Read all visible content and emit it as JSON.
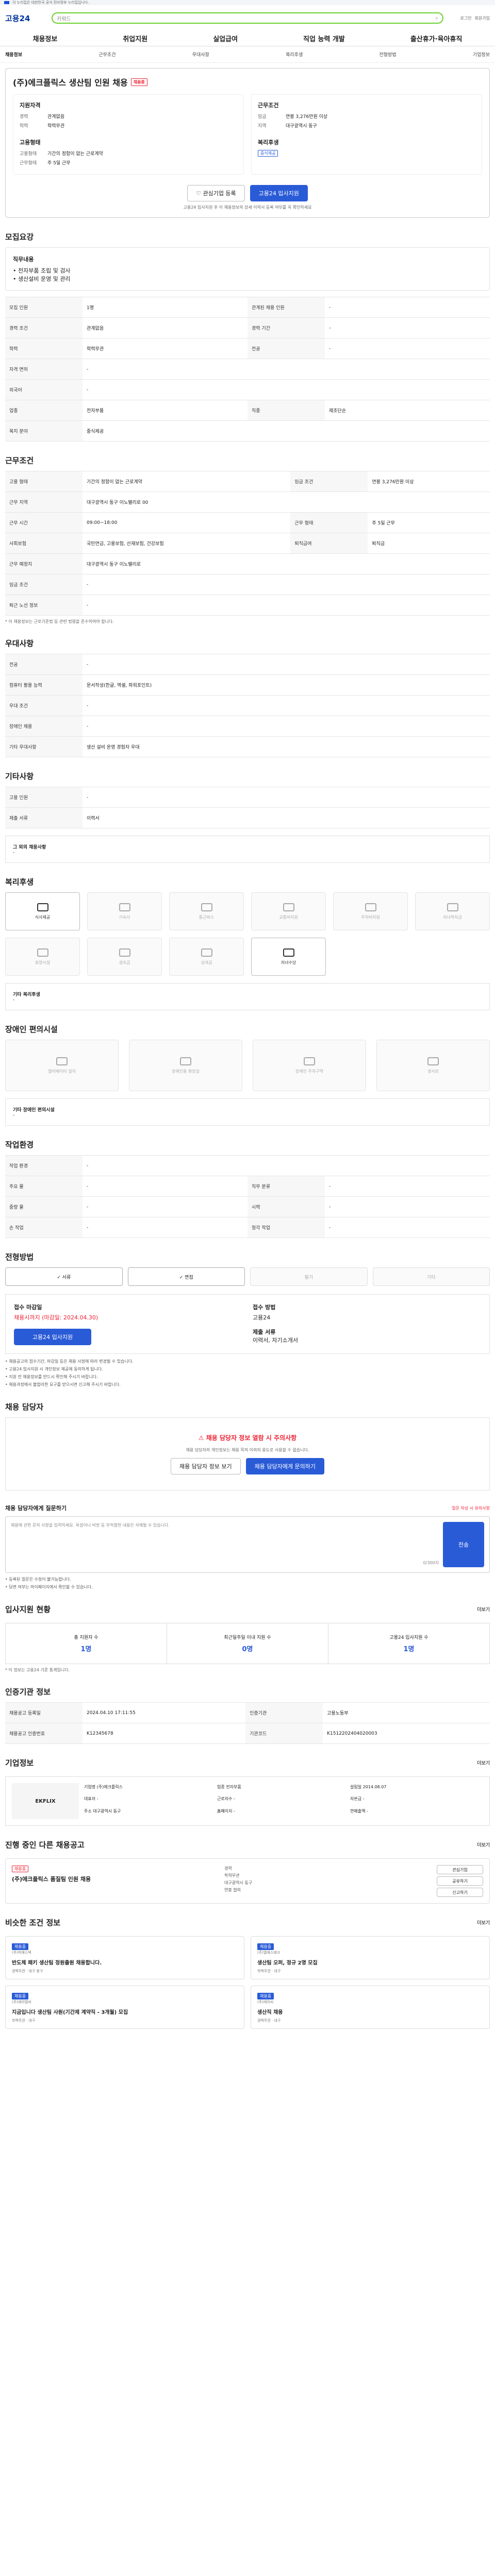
{
  "gov_banner": "이 누리집은 대한민국 공식 전자정부 누리집입니다.",
  "logo": "고용24",
  "search_placeholder": "키워드",
  "utils": [
    "로그인",
    "회원가입"
  ],
  "gnb": [
    "채용정보",
    "취업지원",
    "실업급여",
    "직업 능력 개발",
    "출산휴가·육아휴직"
  ],
  "tabs": [
    "채용정보",
    "근무조건",
    "우대사항",
    "복리후생",
    "전형방법",
    "기업정보"
  ],
  "header": {
    "company": "(주)에크플릭스 생산팀 인원 채용",
    "badge1": "채용중",
    "ref_title": "지원자격",
    "ref": [
      [
        "경력",
        "관계없음"
      ],
      [
        "학력",
        "학력무관"
      ]
    ],
    "cond_title": "근무조건",
    "cond": [
      [
        "임금",
        "연봉 3,276만원 이상"
      ],
      [
        "지역",
        "대구광역시 동구"
      ]
    ],
    "type_title": "고용형태",
    "type": [
      [
        "고용형태",
        "기간의 정함이 없는 근로계약"
      ],
      [
        "근무형태",
        "주 5일 근무"
      ]
    ],
    "welfare_title": "복리후생",
    "welfare": "중식제공"
  },
  "like_btn": "관심기업 등록",
  "apply_btn": "고용24 입사지원",
  "apply_note": "고용24 입사지원 후 이 채용정보의 상세 이력서 등록 여부를 꼭 확인하세요",
  "recruit": {
    "title": "모집요강",
    "task_label": "직무내용",
    "tasks": [
      "• 전자부품 조립 및 검사",
      "• 생산설비 운영 및 관리"
    ],
    "rows": [
      [
        "모집 인원",
        "1명",
        "관계된 채용 인원",
        "-"
      ],
      [
        "경력 조건",
        "관계없음",
        "경력 기간",
        "-"
      ],
      [
        "학력",
        "학력무관",
        "전공",
        "-"
      ],
      [
        "자격 면허",
        "-",
        "",
        ""
      ],
      [
        "외국어",
        "-",
        "",
        ""
      ],
      [
        "업종",
        "전자부품",
        "직종",
        "제조단순"
      ],
      [
        "복지 분야",
        "중식제공",
        "",
        ""
      ]
    ]
  },
  "work": {
    "title": "근무조건",
    "rows": [
      [
        "고용 형태",
        "기간의 정함이 없는 근로계약",
        "임금 조건",
        "연봉 3,276만원 이상"
      ],
      [
        "근무 지역",
        "대구광역시 동구 이노밸리로 00",
        "",
        ""
      ],
      [
        "근무 시간",
        "09:00~18:00",
        "근무 형태",
        "주 5일 근무"
      ],
      [
        "사회보험",
        "국민연금, 고용보험, 산재보험, 건강보험",
        "퇴직급여",
        "퇴직금"
      ],
      [
        "근무 예정지",
        "대구광역시 동구 이노밸리로",
        "",
        ""
      ],
      [
        "임금 조건",
        "-",
        "",
        ""
      ],
      [
        "퇴근 노선 정보",
        "-",
        "",
        ""
      ]
    ],
    "foot": "* 이 채용정보는 근로기준법 등 관련 법령을 준수하여야 합니다."
  },
  "pref": {
    "title": "우대사항",
    "rows": [
      [
        "전공",
        "-"
      ],
      [
        "컴퓨터 활용 능력",
        "문서작성(한글, 엑셀, 파워포인트)"
      ],
      [
        "우대 조건",
        "-"
      ],
      [
        "장애인 채용",
        "-"
      ],
      [
        "기타 우대사항",
        "생산 설비 운영 경험자 우대"
      ]
    ]
  },
  "other": {
    "title": "기타사항",
    "rows": [
      [
        "고용 인원",
        "-"
      ],
      [
        "제출 서류",
        "이력서"
      ]
    ],
    "box_title": "그 외의 채용사항",
    "box": "-"
  },
  "benefit": {
    "title": "복리후생",
    "items": [
      [
        "식사제공",
        true
      ],
      [
        "기숙사",
        false
      ],
      [
        "통근버스",
        false
      ],
      [
        "교통비지원",
        false
      ],
      [
        "주차비지원",
        false
      ],
      [
        "자녀학자금",
        false
      ],
      [
        "휴양시설",
        false
      ],
      [
        "경조금",
        false
      ],
      [
        "성과급",
        false
      ],
      [
        "자녀수당",
        true
      ]
    ],
    "other_title": "기타 복리후생",
    "other": "-"
  },
  "dis": {
    "title": "장애인 편의시설",
    "items": [
      "엘리베이터 설치",
      "장애인용 화장실",
      "장애인 주차구역",
      "경사로"
    ],
    "other_title": "기타 장애인 편의시설",
    "other": "-"
  },
  "workplace": {
    "title": "작업환경",
    "rows": [
      [
        "작업 환경",
        "-",
        "",
        ""
      ],
      [
        "주요 물",
        "-",
        "직무 분류",
        "-"
      ],
      [
        "중량 물",
        "-",
        "시력",
        "-"
      ],
      [
        "손 작업",
        "-",
        "청각 작업",
        "-"
      ]
    ]
  },
  "method": {
    "title": "전형방법",
    "items": [
      [
        "서류",
        true
      ],
      [
        "면접",
        true
      ],
      [
        "필기",
        false
      ],
      [
        "기타",
        false
      ]
    ],
    "apply_title": "접수 마감일",
    "apply_val": "채용시까지 (마감일: 2024.04.30)",
    "method_title": "접수 방법",
    "method_val": "고용24",
    "docs_title": "제출 서류",
    "docs_val": "이력서, 자기소개서",
    "apply_btn": "고용24 입사지원",
    "notes": [
      "• 채용공고의 접수기간, 마감일 등은 채용 사정에 따라 변경될 수 있습니다.",
      "• 고용24 입사지원 시 개인정보 제공에 동의하게 됩니다.",
      "• 지원 전 채용정보를 반드시 확인해 주시기 바랍니다.",
      "• 채용과정에서 불합리한 요구를 받으시면 신고해 주시기 바랍니다."
    ]
  },
  "contact": {
    "title": "채용 담당자",
    "warn": "채용 담당자 정보 열람 시 주의사항",
    "desc": "채용 담당자의 개인정보는 채용 목적 이외의 용도로 사용할 수 없습니다.",
    "btn1": "채용 담당자 정보 보기",
    "btn2": "채용 담당자에게 문의하기"
  },
  "qa": {
    "title": "채용 담당자에게 질문하기",
    "hint": "질문 작성 시 유의사항",
    "placeholder": "채용에 관한 문의 사항을 입력하세요. 욕설이나 비방 등 부적절한 내용은 삭제될 수 있습니다.",
    "count": "0/300자",
    "btn": "전송",
    "notes": [
      "• 등록된 질문은 수정이 불가능합니다.",
      "• 답변 여부는 마이페이지에서 확인할 수 있습니다."
    ]
  },
  "stats": {
    "title": "입사지원 현황",
    "more": "더보기",
    "items": [
      [
        "총 지원자 수",
        "1",
        "명"
      ],
      [
        "최근일주일 이내 지원 수",
        "0",
        "명"
      ],
      [
        "고용24 입사지원 수",
        "1",
        "명"
      ]
    ],
    "note": "* 이 정보는 고용24 기준 통계입니다."
  },
  "info": {
    "title": "인증기관 정보",
    "rows": [
      [
        "채용공고 등록일",
        "2024.04.10 17:11:55",
        "인증기관",
        "고용노동부"
      ],
      [
        "채용공고 인증번호",
        "K12345678",
        "기관코드",
        "K1512202404020003"
      ]
    ],
    "more": "기업 보기"
  },
  "corp": {
    "title": "기업정보",
    "more": "더보기",
    "logo": "EKFLIX",
    "grid": [
      [
        "기업명",
        "(주)에크플릭스"
      ],
      [
        "업종",
        "전자부품"
      ],
      [
        "설립일",
        "2014.08.07"
      ],
      [
        "대표자",
        "-"
      ],
      [
        "근로자수",
        "-"
      ],
      [
        "자본금",
        "-"
      ],
      [
        "주소",
        "대구광역시 동구"
      ],
      [
        "홈페이지",
        "-"
      ],
      [
        "연매출액",
        "-"
      ]
    ]
  },
  "jobs": {
    "title": "진행 중인 다른 채용공고",
    "more": "더보기",
    "card_badge": "채용중",
    "card_title": "(주)에크플릭스 품질팀 인원 채용",
    "card_meta": [
      "경력",
      "학력무관",
      "대구광역시 동구",
      "연봉 협의"
    ],
    "actions": [
      "관심기업",
      "공유하기",
      "신고하기"
    ]
  },
  "similar": {
    "title": "비슷한 조건 정보",
    "more": "더보기",
    "items": [
      [
        "채용중",
        "(주)피에스텍",
        "반도체 패키 생산팀 정원출원 채용합니다.",
        "경력무관 · 대구 동구"
      ],
      [
        "채용중",
        "(주)엘에스테크",
        "생산팀 오퍼, 정규 2명 모집",
        "학력무관 · 대구"
      ],
      [
        "채용중",
        "(주)에이엠씨",
        "지금입니다 생산팀 사원(기간제 계약직 - 3개월) 모집",
        "학력무관 · 대구"
      ],
      [
        "채용중",
        "(주)에이씨",
        "생산직 채용",
        "경력무관 · 대구"
      ]
    ]
  }
}
